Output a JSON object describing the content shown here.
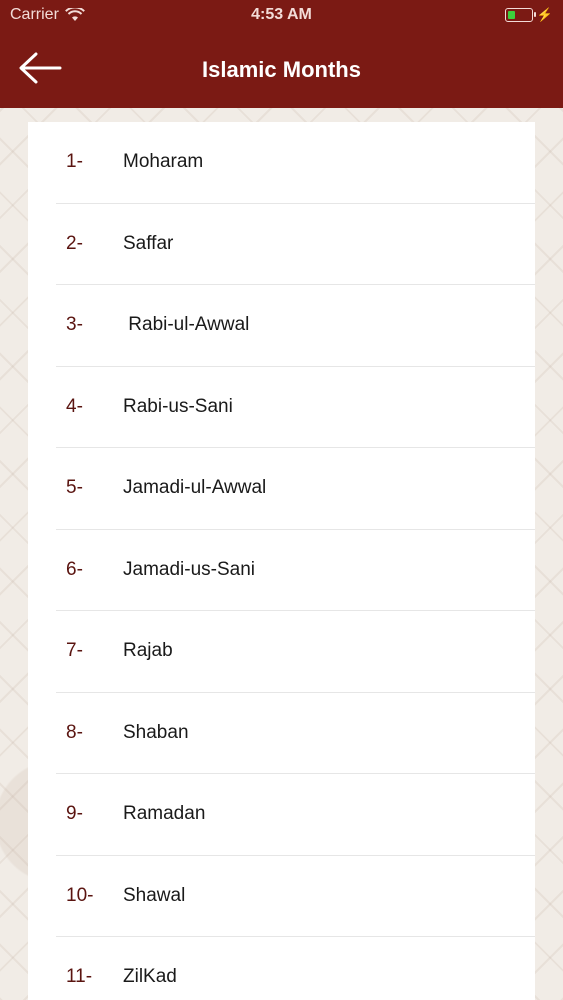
{
  "status_bar": {
    "carrier": "Carrier",
    "time": "4:53 AM"
  },
  "header": {
    "title": "Islamic Months",
    "back_icon": "arrow-left-icon",
    "color": "#7b1a14"
  },
  "months": [
    {
      "num": "1-",
      "name": "Moharam"
    },
    {
      "num": "2-",
      "name": "Saffar"
    },
    {
      "num": "3-",
      "name": " Rabi-ul-Awwal"
    },
    {
      "num": "4-",
      "name": "Rabi-us-Sani"
    },
    {
      "num": "5-",
      "name": "Jamadi-ul-Awwal"
    },
    {
      "num": "6-",
      "name": "Jamadi-us-Sani"
    },
    {
      "num": "7-",
      "name": "Rajab"
    },
    {
      "num": "8-",
      "name": "Shaban"
    },
    {
      "num": "9-",
      "name": "Ramadan"
    },
    {
      "num": "10-",
      "name": "Shawal"
    },
    {
      "num": "11-",
      "name": "ZilKad"
    }
  ]
}
